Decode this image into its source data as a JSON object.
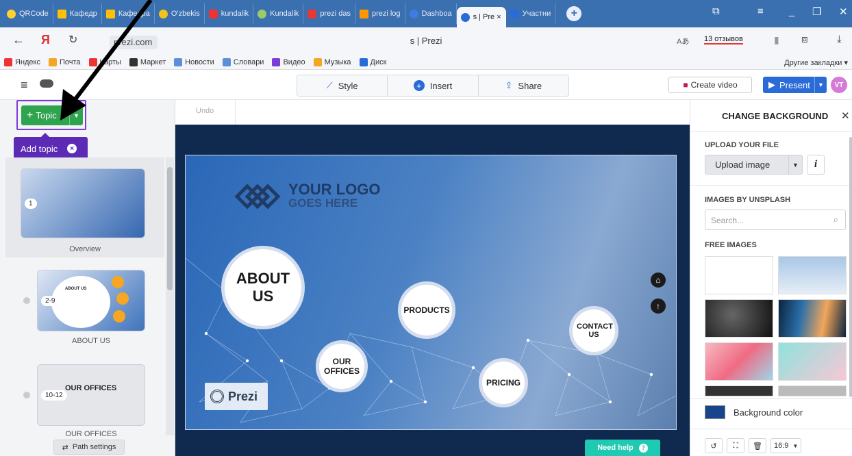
{
  "browser": {
    "tabs": [
      {
        "label": "QRCode",
        "color": "#ffd230"
      },
      {
        "label": "Кафедр",
        "color": "#ffc107"
      },
      {
        "label": "Кафедра",
        "color": "#ffc107"
      },
      {
        "label": "O'zbekis",
        "color": "#f0c419"
      },
      {
        "label": "kundalik",
        "color": "#e33"
      },
      {
        "label": "Kundalik",
        "color": "#9ccc65"
      },
      {
        "label": "prezi das",
        "color": "#e53935"
      },
      {
        "label": "prezi log",
        "color": "#ff9800"
      },
      {
        "label": "Dashboa",
        "color": "#3f7be0"
      },
      {
        "label": "s | Pre ×",
        "color": "#2a6bd7"
      },
      {
        "label": "Участни",
        "color": "#2a6bd7"
      }
    ],
    "url": "prezi.com",
    "page_title": "s | Prezi",
    "reviews": "13 отзывов",
    "bookmarks": [
      {
        "label": "Яндекс",
        "color": "#e33"
      },
      {
        "label": "Почта",
        "color": "#f5a623"
      },
      {
        "label": "Карты",
        "color": "#e33"
      },
      {
        "label": "Маркет",
        "color": "#333"
      },
      {
        "label": "Новости",
        "color": "#5b8fd9"
      },
      {
        "label": "Словари",
        "color": "#5b8fd9"
      },
      {
        "label": "Видео",
        "color": "#7b3bd6"
      },
      {
        "label": "Музыка",
        "color": "#f5a623"
      },
      {
        "label": "Диск",
        "color": "#2a6bd7"
      }
    ],
    "other_bookmarks": "Другие закладки ▾"
  },
  "toolbar": {
    "style": "Style",
    "insert": "Insert",
    "share": "Share",
    "create_video": "Create video",
    "present": "Present",
    "avatar": "VT"
  },
  "left": {
    "topic": "Topic",
    "add_topic": "Add topic",
    "overview_label": "Overview",
    "overview_num": "1",
    "items": [
      {
        "num": "2-9",
        "label": "ABOUT US",
        "thumb_title": "ABOUT US"
      },
      {
        "num": "10-12",
        "label": "OUR OFFICES",
        "thumb_title": "OUR OFFICES"
      }
    ],
    "path_settings": "Path settings"
  },
  "canvas": {
    "undo": "Undo",
    "logo_line1": "YOUR LOGO",
    "logo_line2": "GOES HERE",
    "about": "ABOUT US",
    "products": "PRODUCTS",
    "contact": "CONTACT US",
    "offices": "OUR OFFICES",
    "pricing": "PRICING",
    "prezi": "Prezi",
    "need_help": "Need help"
  },
  "right": {
    "title": "CHANGE BACKGROUND",
    "upload_section": "UPLOAD YOUR FILE",
    "upload_button": "Upload image",
    "unsplash_section": "IMAGES BY UNSPLASH",
    "search_placeholder": "Search...",
    "free_section": "FREE IMAGES",
    "background_color": "Background color",
    "ratio": "16:9"
  }
}
